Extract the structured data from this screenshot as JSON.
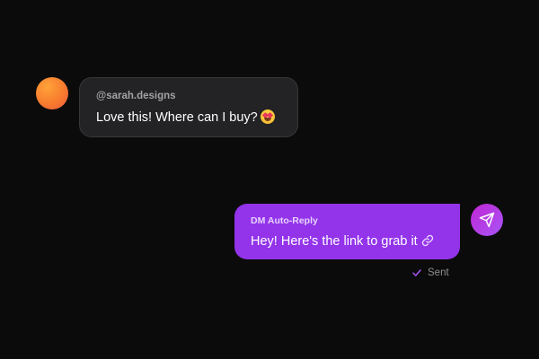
{
  "comment": {
    "handle": "@sarah.designs",
    "text": "Love this! Where can I buy?",
    "emoji": "star-struck-emoji"
  },
  "reply": {
    "label": "DM Auto-Reply",
    "text": "Hey! Here's the link to grab it",
    "icon": "link-icon"
  },
  "status": {
    "text": "Sent",
    "icon": "check-icon"
  },
  "colors": {
    "background": "#0b0b0c",
    "incoming_bubble": "#232325",
    "outgoing_bubble": "#9333ea",
    "accent": "#a855f7"
  }
}
